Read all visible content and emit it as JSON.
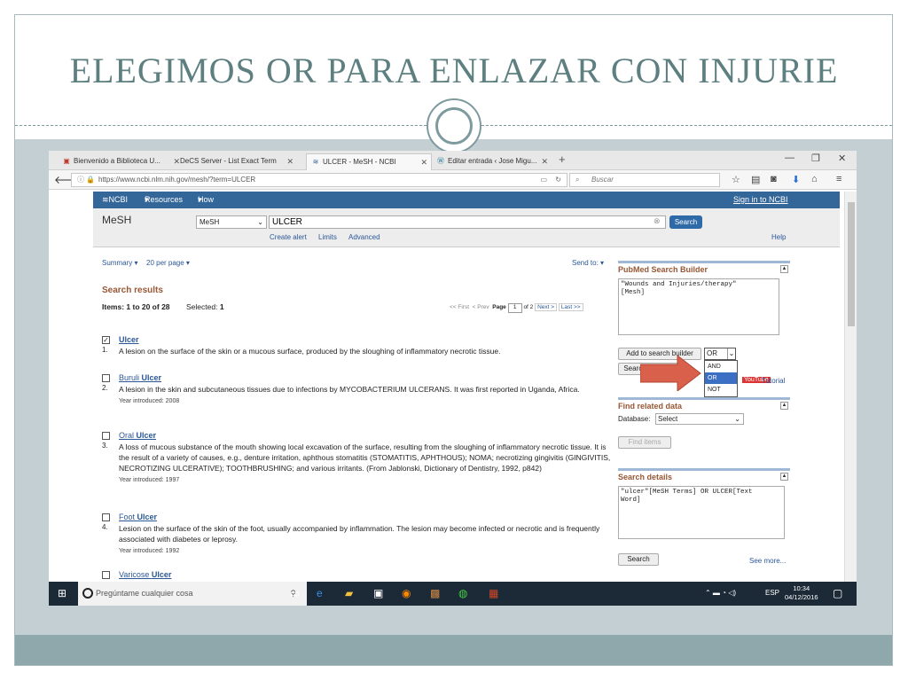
{
  "slide": {
    "title": "ELEGIMOS OR PARA ENLAZAR CON INJURIE"
  },
  "browser": {
    "tabs": [
      {
        "label": "Bienvenido a Biblioteca U...",
        "icon": "library-icon",
        "active": false
      },
      {
        "label": "DeCS Server - List Exact Term",
        "icon": "",
        "active": false
      },
      {
        "label": "ULCER - MeSH - NCBI",
        "icon": "ncbi-icon",
        "active": true
      },
      {
        "label": "Editar entrada ‹ Jose Migu...",
        "icon": "wordpress-icon",
        "active": false
      }
    ],
    "new_tab": "+",
    "url": "https://www.ncbi.nlm.nih.gov/mesh/?term=ULCER",
    "search_placeholder": "Buscar"
  },
  "ncbi": {
    "logo": "NCBI",
    "resources": "Resources",
    "how_to": "How To",
    "sign_in": "Sign in to NCBI",
    "db_title": "MeSH",
    "db_select": "MeSH",
    "term": "ULCER",
    "search_button": "Search",
    "create_alert": "Create alert",
    "limits": "Limits",
    "advanced": "Advanced",
    "help": "Help"
  },
  "results": {
    "summary": "Summary",
    "per_page": "20 per page",
    "send_to": "Send to:",
    "heading": "Search results",
    "items_label": "Items: 1 to 20 of 28",
    "selected_label": "Selected:",
    "selected_count": "1",
    "pager": {
      "first": "<< First",
      "prev": "< Prev",
      "page_label": "Page",
      "page_value": "1",
      "of": "of 2",
      "next": "Next >",
      "last": "Last >>"
    },
    "items": [
      {
        "num": "1.",
        "title_pre": "",
        "title_bold": "Ulcer",
        "checked": true,
        "desc": "A lesion on the surface of the skin or a mucous surface, produced by the sloughing of inflammatory necrotic tissue.",
        "year": ""
      },
      {
        "num": "2.",
        "title_pre": "Buruli ",
        "title_bold": "Ulcer",
        "checked": false,
        "desc": "A lesion in the skin and subcutaneous tissues due to infections by MYCOBACTERIUM ULCERANS. It was first reported in Uganda, Africa.",
        "year": "Year introduced: 2008"
      },
      {
        "num": "3.",
        "title_pre": "Oral ",
        "title_bold": "Ulcer",
        "checked": false,
        "desc": "A loss of mucous substance of the mouth showing local excavation of the surface, resulting from the sloughing of inflammatory necrotic tissue. It is the result of a variety of causes, e.g., denture irritation, aphthous stomatitis (STOMATITIS, APHTHOUS); NOMA; necrotizing gingivitis (GINGIVITIS, NECROTIZING ULCERATIVE); TOOTHBRUSHING; and various irritants. (From Jablonski, Dictionary of Dentistry, 1992, p842)",
        "year": "Year introduced: 1997"
      },
      {
        "num": "4.",
        "title_pre": "Foot ",
        "title_bold": "Ulcer",
        "checked": false,
        "desc": "Lesion on the surface of the skin of the foot, usually accompanied by inflammation. The lesion may become infected or necrotic and is frequently associated with diabetes or leprosy.",
        "year": "Year introduced: 1992"
      },
      {
        "num": "",
        "title_pre": "Varicose ",
        "title_bold": "Ulcer",
        "checked": false,
        "desc": "",
        "year": ""
      }
    ]
  },
  "sidebar": {
    "builder_title": "PubMed Search Builder",
    "builder_text": "\"Wounds and Injuries/therapy\"\n[Mesh]",
    "add_button": "Add to search builder",
    "operator": "OR",
    "operator_options": [
      "AND",
      "OR",
      "NOT"
    ],
    "search_pubmed": "Search PubMed",
    "youtube": "YouTube",
    "tutorial": "Tutorial",
    "find_related_title": "Find related data",
    "database_label": "Database:",
    "database_value": "Select",
    "find_items": "Find items",
    "details_title": "Search details",
    "details_text": "\"ulcer\"[MeSH Terms] OR ULCER[Text\nWord]",
    "details_search": "Search",
    "see_more": "See more..."
  },
  "taskbar": {
    "search_placeholder": "Pregúntame cualquier cosa",
    "lang": "ESP",
    "time": "10:34",
    "date": "04/12/2016"
  },
  "colors": {
    "slide_accent": "#5e7f80",
    "ncbi_blue": "#336699",
    "result_header": "#985735",
    "arrow": "#d9604a"
  }
}
